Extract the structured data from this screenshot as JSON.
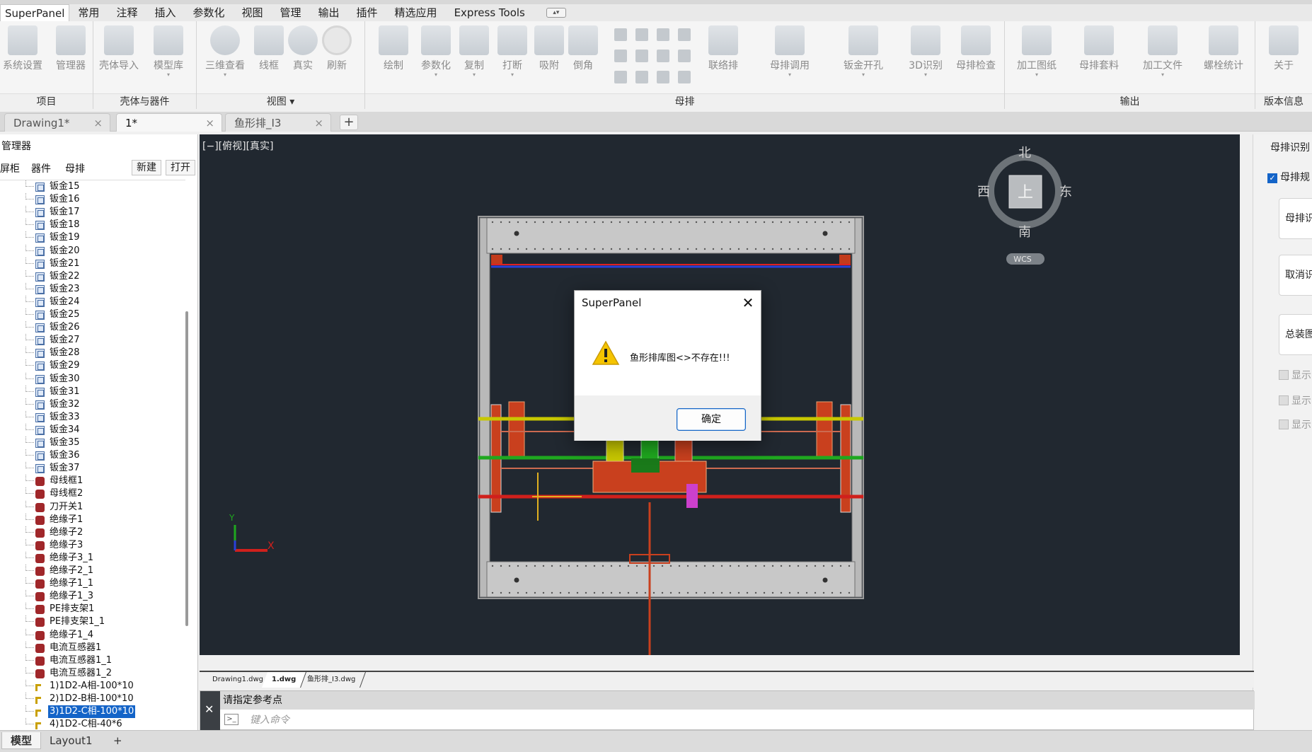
{
  "app": {
    "name": "SuperPanel"
  },
  "ribbon": {
    "tabs": [
      "SuperPanel",
      "常用",
      "注释",
      "插入",
      "参数化",
      "视图",
      "管理",
      "输出",
      "插件",
      "精选应用",
      "Express Tools"
    ],
    "groups": {
      "project": {
        "title": "项目",
        "buttons": [
          "系统设置",
          "管理器"
        ]
      },
      "shell": {
        "title": "壳体与器件",
        "buttons": [
          "壳体导入",
          "模型库"
        ]
      },
      "view": {
        "title": "视图",
        "buttons": [
          "三维查看",
          "线框",
          "真实",
          "刷新"
        ]
      },
      "busbar": {
        "title": "母排",
        "buttons": [
          "绘制",
          "参数化",
          "复制",
          "打断",
          "吸附",
          "倒角",
          "联络排",
          "母排调用",
          "钣金开孔",
          "3D识别",
          "母排检查"
        ]
      },
      "output": {
        "title": "输出",
        "buttons": [
          "加工图纸",
          "母排套料",
          "加工文件",
          "螺栓统计"
        ]
      },
      "version": {
        "title": "版本信息",
        "buttons": [
          "关于"
        ]
      }
    }
  },
  "doc_tabs": [
    {
      "label": "Drawing1*",
      "close": "×"
    },
    {
      "label": "1*",
      "close": "×"
    },
    {
      "label": "鱼形排_I3",
      "close": "×"
    }
  ],
  "doc_add": "+",
  "manager": {
    "title": "管理器",
    "tabs": [
      "屏柜",
      "器件",
      "母排"
    ],
    "new_btn": "新建",
    "open_btn": "打开",
    "items": [
      {
        "label": "钣金15",
        "type": "sheet"
      },
      {
        "label": "钣金16",
        "type": "sheet"
      },
      {
        "label": "钣金17",
        "type": "sheet"
      },
      {
        "label": "钣金18",
        "type": "sheet"
      },
      {
        "label": "钣金19",
        "type": "sheet"
      },
      {
        "label": "钣金20",
        "type": "sheet"
      },
      {
        "label": "钣金21",
        "type": "sheet"
      },
      {
        "label": "钣金22",
        "type": "sheet"
      },
      {
        "label": "钣金23",
        "type": "sheet"
      },
      {
        "label": "钣金24",
        "type": "sheet"
      },
      {
        "label": "钣金25",
        "type": "sheet"
      },
      {
        "label": "钣金26",
        "type": "sheet"
      },
      {
        "label": "钣金27",
        "type": "sheet"
      },
      {
        "label": "钣金28",
        "type": "sheet"
      },
      {
        "label": "钣金29",
        "type": "sheet"
      },
      {
        "label": "钣金30",
        "type": "sheet"
      },
      {
        "label": "钣金31",
        "type": "sheet"
      },
      {
        "label": "钣金32",
        "type": "sheet"
      },
      {
        "label": "钣金33",
        "type": "sheet"
      },
      {
        "label": "钣金34",
        "type": "sheet"
      },
      {
        "label": "钣金35",
        "type": "sheet"
      },
      {
        "label": "钣金36",
        "type": "sheet"
      },
      {
        "label": "钣金37",
        "type": "sheet"
      },
      {
        "label": "母线框1",
        "type": "comp"
      },
      {
        "label": "母线框2",
        "type": "comp"
      },
      {
        "label": "刀开关1",
        "type": "comp"
      },
      {
        "label": "绝缘子1",
        "type": "comp"
      },
      {
        "label": "绝缘子2",
        "type": "comp"
      },
      {
        "label": "绝缘子3",
        "type": "comp"
      },
      {
        "label": "绝缘子3_1",
        "type": "comp"
      },
      {
        "label": "绝缘子2_1",
        "type": "comp"
      },
      {
        "label": "绝缘子1_1",
        "type": "comp"
      },
      {
        "label": "绝缘子1_3",
        "type": "comp"
      },
      {
        "label": "PE排支架1",
        "type": "comp"
      },
      {
        "label": "PE排支架1_1",
        "type": "comp"
      },
      {
        "label": "绝缘子1_4",
        "type": "comp"
      },
      {
        "label": "电流互感器1",
        "type": "comp"
      },
      {
        "label": "电流互感器1_1",
        "type": "comp"
      },
      {
        "label": "电流互感器1_2",
        "type": "comp"
      },
      {
        "label": "1)1D2-A相-100*10",
        "type": "bus"
      },
      {
        "label": "2)1D2-B相-100*10",
        "type": "bus"
      },
      {
        "label": "3)1D2-C相-100*10",
        "type": "bus",
        "selected": true
      },
      {
        "label": "4)1D2-C相-40*6",
        "type": "bus"
      }
    ]
  },
  "viewport": {
    "label": "[−][俯视][真实]",
    "viewcube": {
      "north": "北",
      "south": "南",
      "east": "东",
      "west": "西",
      "top": "上",
      "wcs": "WCS"
    },
    "ucs": {
      "x": "X",
      "y": "Y"
    }
  },
  "right_panel": {
    "title": "母排识别",
    "checkbox": "母排规",
    "buttons": [
      "母排识",
      "取消识",
      "总装图"
    ],
    "checks": [
      "显示",
      "显示",
      "显示"
    ]
  },
  "file_tabs": [
    "Drawing1.dwg",
    "1.dwg",
    "鱼形排_I3.dwg"
  ],
  "command": {
    "history": "请指定参考点",
    "placeholder": "键入命令",
    "close": "✕"
  },
  "layout_tabs": [
    "模型",
    "Layout1",
    "+"
  ],
  "dialog": {
    "title": "SuperPanel",
    "close": "✕",
    "message": "鱼形排库图<>不存在!!!",
    "ok": "确定"
  },
  "colors": {
    "viewport_bg": "#212830",
    "phase_yellow": "#c8c800",
    "phase_green": "#1fa81f",
    "phase_red": "#d0201c",
    "accent_blue": "#1464c8"
  }
}
